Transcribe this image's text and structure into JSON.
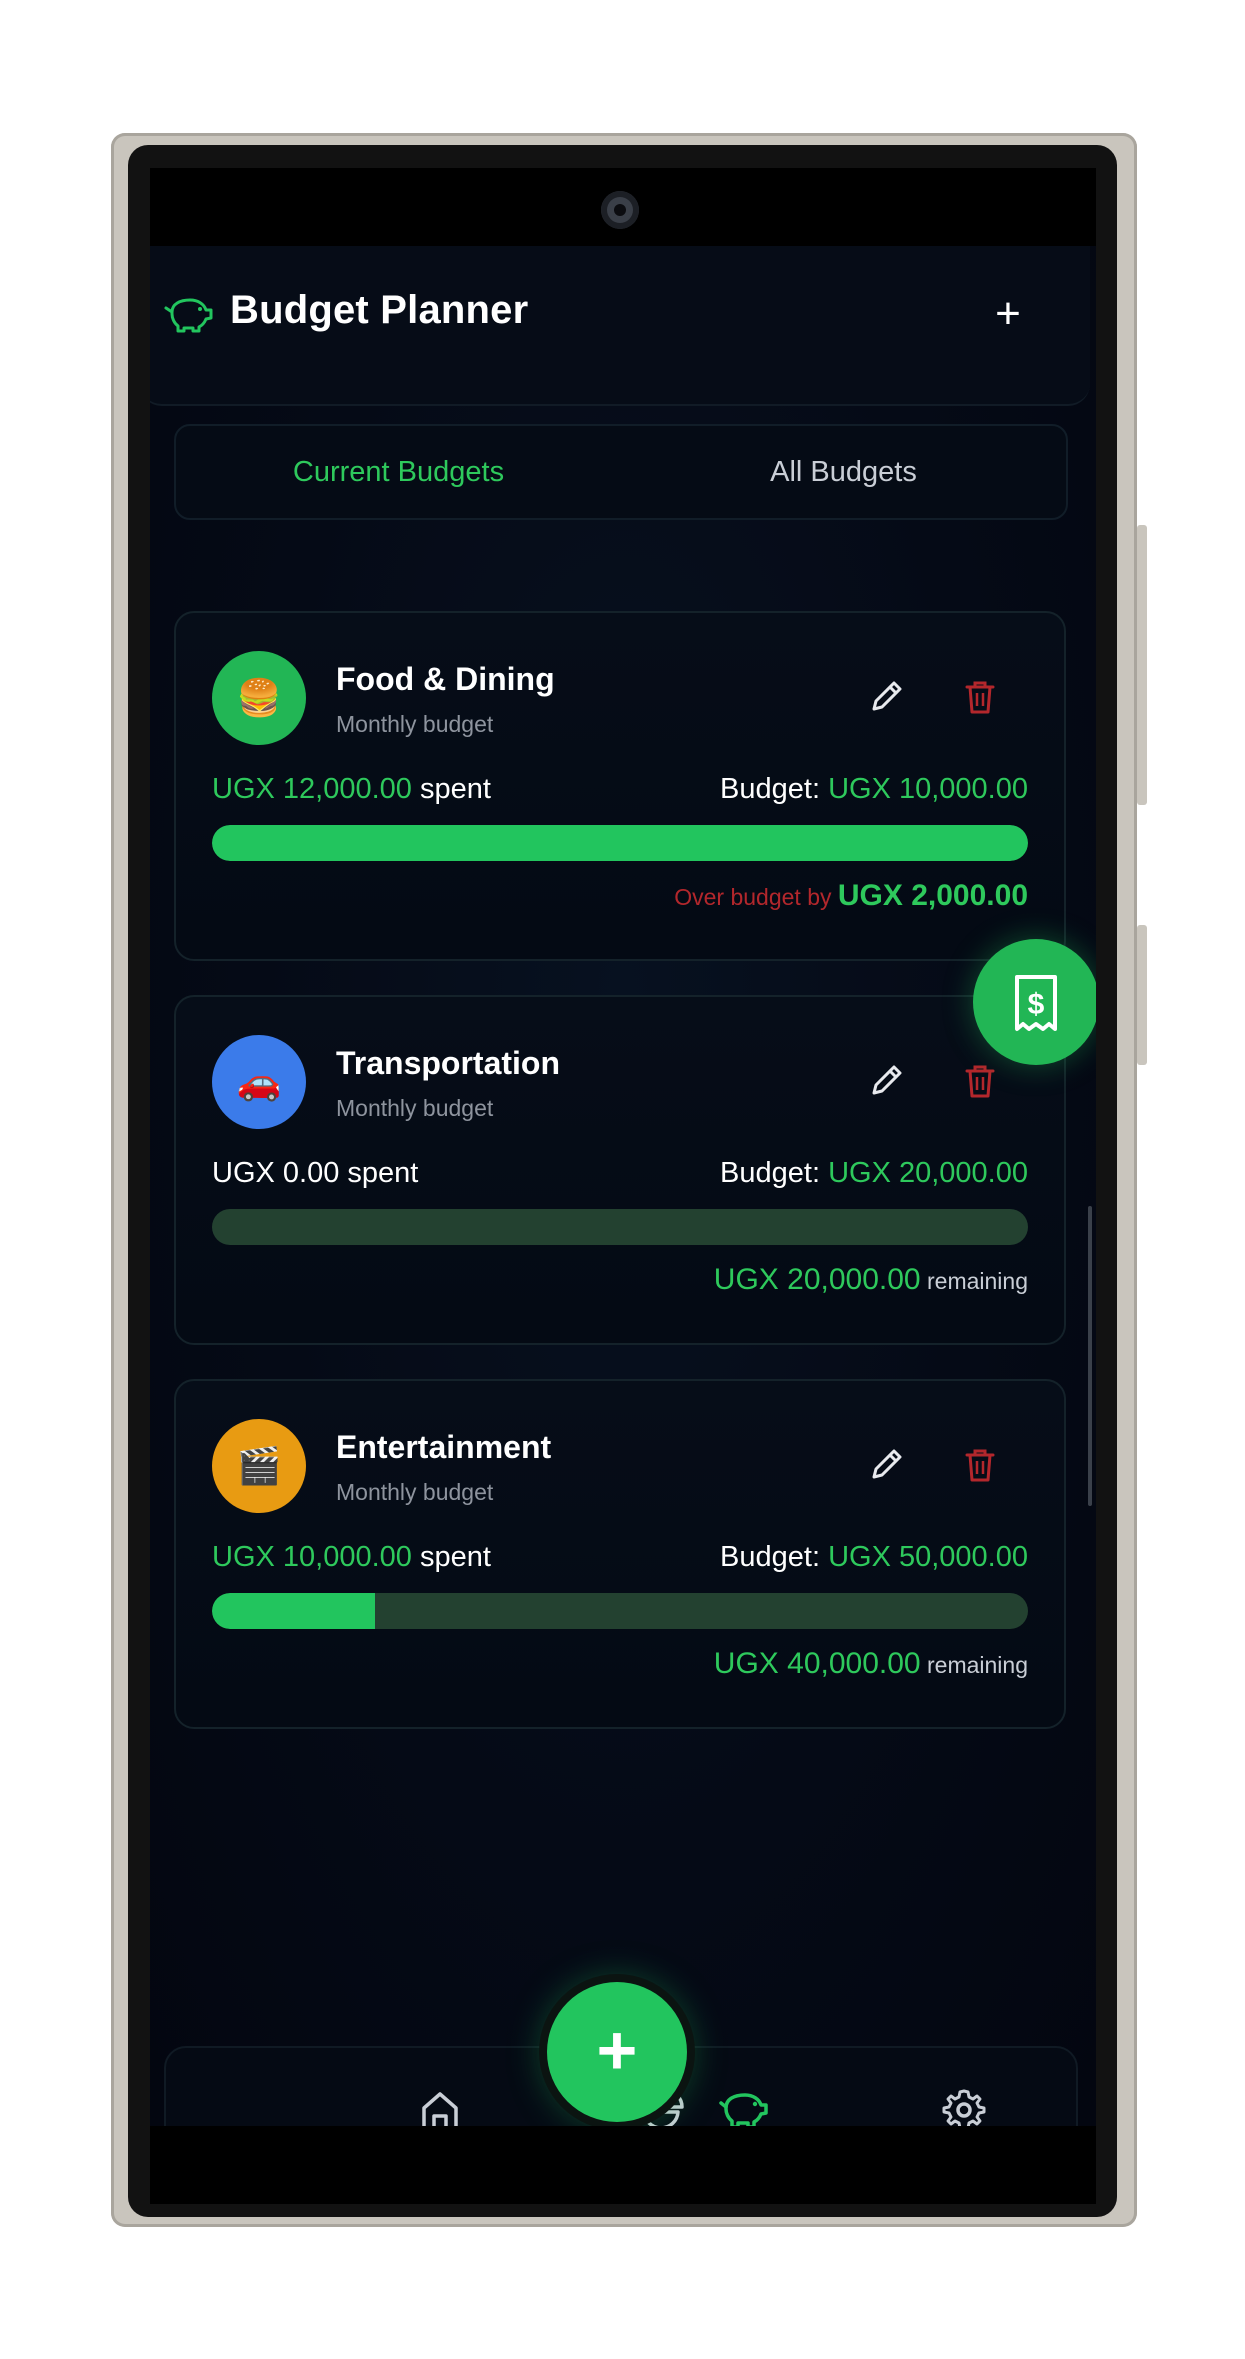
{
  "header": {
    "title": "Budget Planner",
    "add_label": "+"
  },
  "tabs": [
    {
      "label": "Current Budgets",
      "active": true
    },
    {
      "label": "All Budgets",
      "active": false
    }
  ],
  "budgets": [
    {
      "name": "Food & Dining",
      "subtitle": "Monthly budget",
      "icon": "burger-icon",
      "icon_glyph": "🍔",
      "icon_color": "#22b655",
      "spent_amount": "UGX 12,000.00",
      "spent_suffix": " spent",
      "budget_prefix": "Budget: ",
      "budget_amount": "UGX 10,000.00",
      "progress": 1.0,
      "status_prefix": "Over budget by ",
      "status_amount": "UGX 2,000.00",
      "status_suffix": ""
    },
    {
      "name": "Transportation",
      "subtitle": "Monthly budget",
      "icon": "car-icon",
      "icon_glyph": "🚗",
      "icon_color": "#3b7bea",
      "spent_amount": "UGX 0.00",
      "spent_suffix": " spent",
      "budget_prefix": "Budget: ",
      "budget_amount": "UGX 20,000.00",
      "progress": 0.0,
      "status_prefix": "",
      "status_amount": "UGX 20,000.00",
      "status_suffix": " remaining"
    },
    {
      "name": "Entertainment",
      "subtitle": "Monthly budget",
      "icon": "clapperboard-icon",
      "icon_glyph": "🎬",
      "icon_color": "#e89b12",
      "spent_amount": "UGX 10,000.00",
      "spent_suffix": " spent",
      "budget_prefix": "Budget: ",
      "budget_amount": "UGX 50,000.00",
      "progress": 0.2,
      "status_prefix": "",
      "status_amount": "UGX 40,000.00",
      "status_suffix": " remaining"
    }
  ],
  "fab": {
    "label": "+"
  },
  "nav": [
    {
      "name": "home-icon",
      "active": false
    },
    {
      "name": "pie-chart-icon",
      "active": false
    },
    {
      "name": "piggy-bank-icon",
      "active": true
    },
    {
      "name": "settings-icon",
      "active": false
    }
  ],
  "colors": {
    "accent": "#22c55e",
    "over_budget": "#b3272c",
    "background": "#02040c"
  }
}
